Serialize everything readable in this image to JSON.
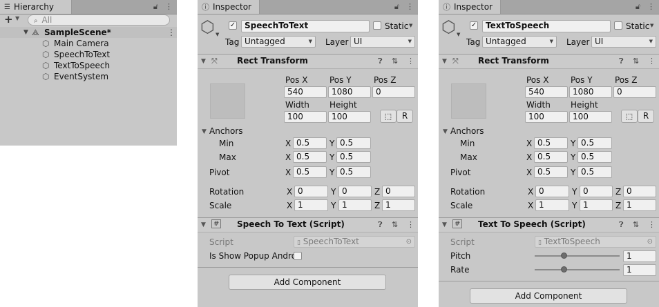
{
  "hierarchy": {
    "tab_title": "Hierarchy",
    "add_label": "+",
    "search_placeholder": "All",
    "scene_name": "SampleScene*",
    "objects": [
      "Main Camera",
      "SpeechToText",
      "TextToSpeech",
      "EventSystem"
    ]
  },
  "inspector1": {
    "tab_title": "Inspector",
    "object_name": "SpeechToText",
    "static_label": "Static",
    "tag_label": "Tag",
    "tag_value": "Untagged",
    "layer_label": "Layer",
    "layer_value": "UI",
    "rect_title": "Rect Transform",
    "pos_x_label": "Pos X",
    "pos_y_label": "Pos Y",
    "pos_z_label": "Pos Z",
    "pos_x": "540",
    "pos_y": "1080",
    "pos_z": "0",
    "width_label": "Width",
    "height_label": "Height",
    "width": "100",
    "height": "100",
    "r_label": "R",
    "anchors_label": "Anchors",
    "min_label": "Min",
    "max_label": "Max",
    "pivot_label": "Pivot",
    "x_label": "X",
    "y_label": "Y",
    "z_label": "Z",
    "min_x": "0.5",
    "min_y": "0.5",
    "max_x": "0.5",
    "max_y": "0.5",
    "pivot_x": "0.5",
    "pivot_y": "0.5",
    "rotation_label": "Rotation",
    "rot_x": "0",
    "rot_y": "0",
    "rot_z": "0",
    "scale_label": "Scale",
    "scale_x": "1",
    "scale_y": "1",
    "scale_z": "1",
    "script_component_title": "Speech To Text (Script)",
    "script_label": "Script",
    "script_value": "SpeechToText",
    "prop1_label": "Is Show Popup Andro",
    "add_component": "Add Component"
  },
  "inspector2": {
    "tab_title": "Inspector",
    "object_name": "TextToSpeech",
    "static_label": "Static",
    "tag_label": "Tag",
    "tag_value": "Untagged",
    "layer_label": "Layer",
    "layer_value": "UI",
    "rect_title": "Rect Transform",
    "pos_x_label": "Pos X",
    "pos_y_label": "Pos Y",
    "pos_z_label": "Pos Z",
    "pos_x": "540",
    "pos_y": "1080",
    "pos_z": "0",
    "width_label": "Width",
    "height_label": "Height",
    "width": "100",
    "height": "100",
    "r_label": "R",
    "anchors_label": "Anchors",
    "min_label": "Min",
    "max_label": "Max",
    "pivot_label": "Pivot",
    "x_label": "X",
    "y_label": "Y",
    "z_label": "Z",
    "min_x": "0.5",
    "min_y": "0.5",
    "max_x": "0.5",
    "max_y": "0.5",
    "pivot_x": "0.5",
    "pivot_y": "0.5",
    "rotation_label": "Rotation",
    "rot_x": "0",
    "rot_y": "0",
    "rot_z": "0",
    "scale_label": "Scale",
    "scale_x": "1",
    "scale_y": "1",
    "scale_z": "1",
    "script_component_title": "Text To Speech (Script)",
    "script_label": "Script",
    "script_value": "TextToSpeech",
    "pitch_label": "Pitch",
    "pitch_value": "1",
    "rate_label": "Rate",
    "rate_value": "1",
    "add_component": "Add Component"
  },
  "icons": {
    "lock": "lock-icon",
    "menu": "kebab-menu-icon",
    "help": "help-icon",
    "settings": "preset-icon",
    "cube": "gameobject-cube-icon",
    "search": "search-icon"
  },
  "colors": {
    "panel_bg": "#c8c8c8",
    "tab_bar": "#a5a5a5",
    "selection": "#c8c8c8"
  }
}
